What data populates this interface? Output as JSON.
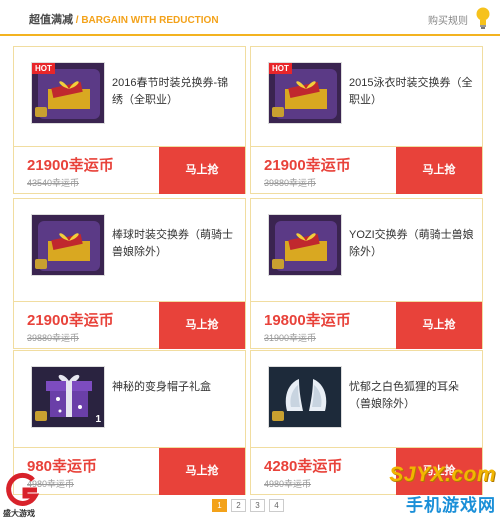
{
  "header": {
    "title": "超值满减",
    "subtitle": " / BARGAIN WITH REDUCTION",
    "rules_link": "购买规则"
  },
  "products": [
    {
      "name": "2016春节时装兑换券-锦绣（全职业）",
      "price": "21900幸运币",
      "old_price": "43540幸运币",
      "buy": "马上抢",
      "hot": "HOT",
      "icon": "coupon-box-icon"
    },
    {
      "name": "2015泳衣时装交换券（全职业）",
      "price": "21900幸运币",
      "old_price": "39880幸运币",
      "buy": "马上抢",
      "hot": "HOT",
      "icon": "coupon-box-icon"
    },
    {
      "name": "棒球时装交换券（萌骑士兽娘除外）",
      "price": "21900幸运币",
      "old_price": "39880幸运币",
      "buy": "马上抢",
      "icon": "coupon-box-icon"
    },
    {
      "name": "YOZI交换券（萌骑士兽娘除外）",
      "price": "19800幸运币",
      "old_price": "31900幸运币",
      "buy": "马上抢",
      "icon": "coupon-box-icon"
    },
    {
      "name": "神秘的变身帽子礼盒",
      "price": "980幸运币",
      "old_price": "4980幸运币",
      "buy": "马上抢",
      "qty": "1",
      "icon": "gift-box-icon"
    },
    {
      "name": "忧郁之白色狐狸的耳朵（兽娘除外）",
      "price": "4280幸运币",
      "old_price": "4980幸运币",
      "buy": "马上抢",
      "icon": "fox-ears-icon"
    }
  ],
  "pagination": [
    "1",
    "2",
    "3",
    "4"
  ],
  "watermark": {
    "left_text": "盛大游戏",
    "site": "SJYX.com",
    "slogan": "手机游戏网"
  },
  "colors": {
    "accent": "#f3a21a",
    "price_red": "#e8423a",
    "card_border": "#f1dda0"
  }
}
